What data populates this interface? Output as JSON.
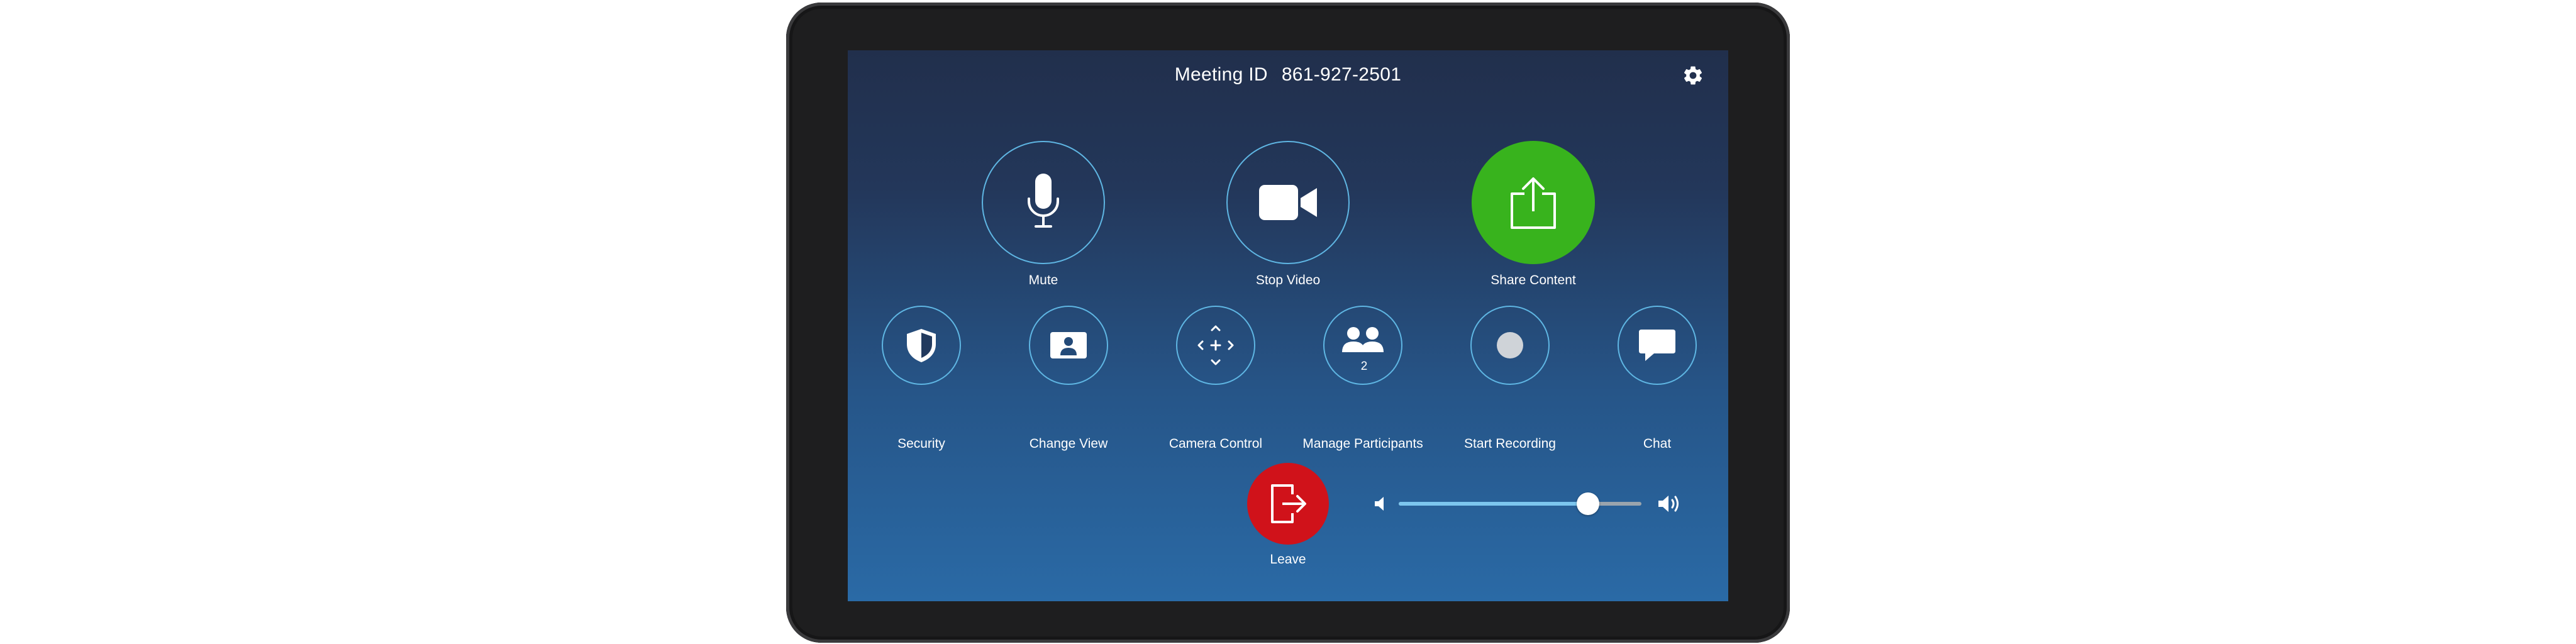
{
  "header": {
    "meeting_id_label": "Meeting ID",
    "meeting_id_value": "861-927-2501"
  },
  "primary_actions": {
    "mute": "Mute",
    "stop_video": "Stop Video",
    "share_content": "Share Content"
  },
  "secondary_actions": {
    "security": "Security",
    "change_view": "Change View",
    "camera_control": "Camera Control",
    "manage_participants": "Manage Participants",
    "participant_count": "2",
    "start_recording": "Start Recording",
    "chat": "Chat"
  },
  "leave": {
    "label": "Leave"
  },
  "volume": {
    "level": 0.78
  },
  "colors": {
    "accent_ring": "#5fb6e3",
    "share_green": "#38b31d",
    "leave_red": "#d0121a"
  },
  "icons": [
    "gear-icon",
    "microphone-icon",
    "video-camera-icon",
    "share-upload-icon",
    "shield-icon",
    "change-view-icon",
    "camera-control-icon",
    "participants-icon",
    "record-icon",
    "chat-icon",
    "leave-icon",
    "volume-low-icon",
    "volume-high-icon"
  ]
}
